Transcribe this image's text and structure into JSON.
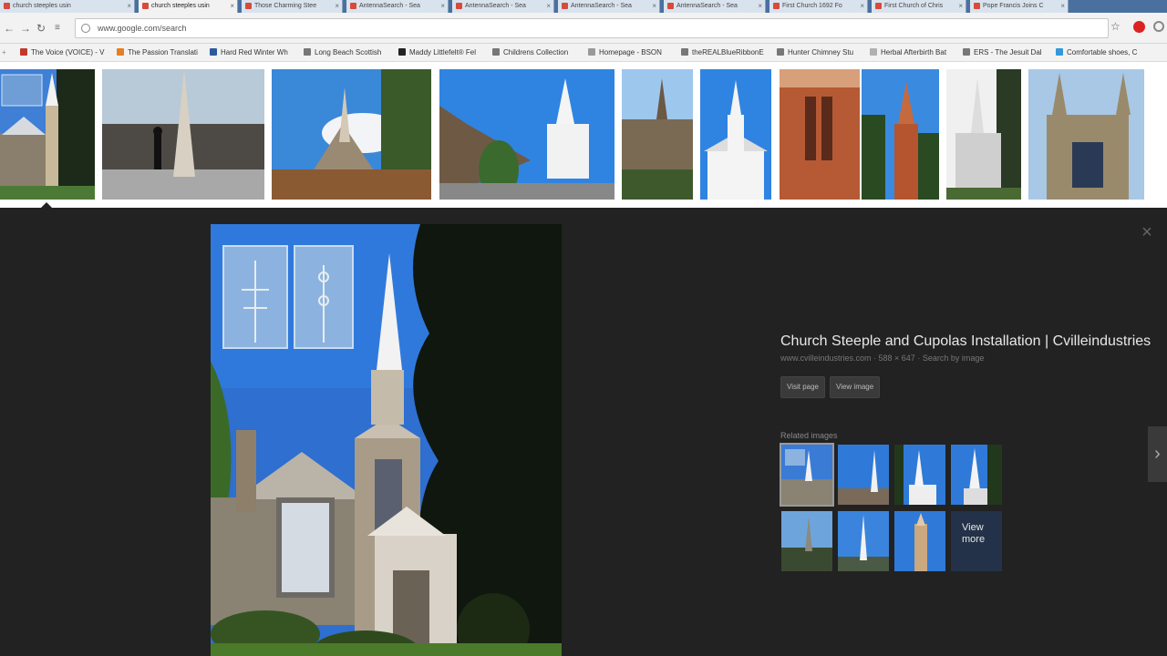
{
  "tabs": [
    {
      "label": "church steeples usin",
      "active": false
    },
    {
      "label": "church steeples usin",
      "active": true
    },
    {
      "label": "Those Charming Stee",
      "active": false
    },
    {
      "label": "AntennaSearch - Sea",
      "active": false
    },
    {
      "label": "AntennaSearch - Sea",
      "active": false
    },
    {
      "label": "AntennaSearch - Sea",
      "active": false
    },
    {
      "label": "AntennaSearch - Sea",
      "active": false
    },
    {
      "label": "First Church 1692 Fo",
      "active": false
    },
    {
      "label": "First Church of Chris",
      "active": false
    },
    {
      "label": "Pope Francis Joins C",
      "active": false
    }
  ],
  "address_bar": {
    "url": "www.google.com/search"
  },
  "bookmarks": [
    {
      "label": "The Voice (VOICE) - V",
      "color": "#c0392b"
    },
    {
      "label": "The Passion Translati",
      "color": "#e67e22"
    },
    {
      "label": "Hard Red Winter Wh",
      "color": "#2c5aa0"
    },
    {
      "label": "Long Beach Scottish",
      "color": "#777777"
    },
    {
      "label": "Maddy Littlefelt® Fel",
      "color": "#222222"
    },
    {
      "label": "Childrens Collection",
      "color": "#777777"
    },
    {
      "label": "Homepage - BSON",
      "color": "#999999"
    },
    {
      "label": "theREALBlueRibbonE",
      "color": "#777777"
    },
    {
      "label": "Hunter Chimney Stu",
      "color": "#777777"
    },
    {
      "label": "Herbal Afterbirth Bat",
      "color": "#b0b0b0"
    },
    {
      "label": "ERS - The Jesuit Dal",
      "color": "#777777"
    },
    {
      "label": "Comfortable shoes, C",
      "color": "#3498db"
    }
  ],
  "preview": {
    "title": "Church Steeple and Cupolas Installation | Cvilleindustries",
    "meta": "www.cvilleindustries.com · 588 × 647 · Search by image",
    "visit_page": "Visit page",
    "view_image": "View image",
    "related_label": "Related images",
    "view_more_label": "View more"
  },
  "icons": {
    "back": "back-arrow-icon",
    "forward": "forward-arrow-icon",
    "reload": "reload-icon",
    "bookmark_star": "star-icon",
    "close": "close-icon",
    "next": "chevron-right-icon"
  }
}
